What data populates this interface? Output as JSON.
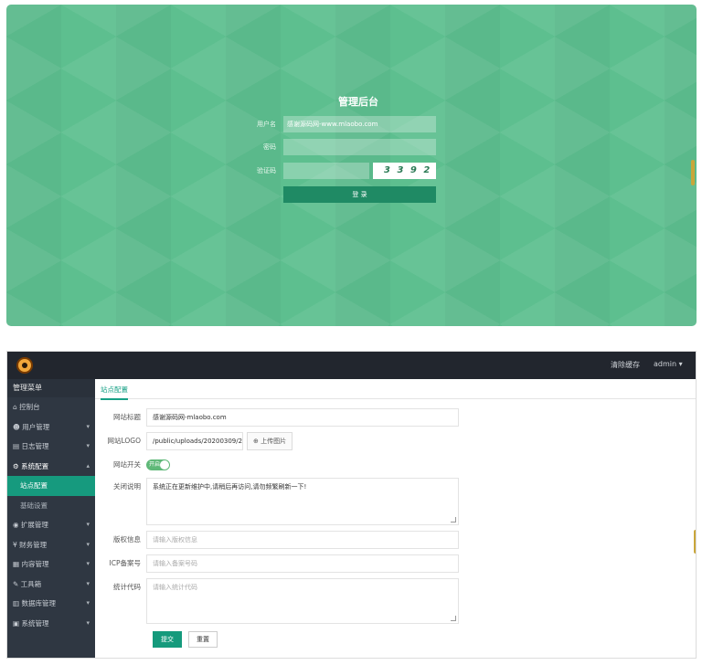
{
  "login": {
    "title": "管理后台",
    "username_label": "用户名",
    "username_value": "感谢源码网-www.mlaobo.com",
    "password_label": "密码",
    "password_value": "",
    "captcha_label": "验证码",
    "captcha_value": "",
    "captcha_image_text": "3 3 9 2",
    "login_button": "登 录"
  },
  "topbar": {
    "clear_cache": "清除缓存",
    "user": "admin ▾"
  },
  "sidebar": {
    "title": "管理菜单",
    "items": [
      {
        "label": "控制台",
        "icon": "home-icon",
        "caret": ""
      },
      {
        "label": "用户管理",
        "icon": "user-icon",
        "caret": "▾"
      },
      {
        "label": "日志管理",
        "icon": "log-icon",
        "caret": "▾"
      },
      {
        "label": "系统配置",
        "icon": "gear-icon",
        "caret": "▴"
      },
      {
        "label": "站点配置",
        "icon": "",
        "caret": ""
      },
      {
        "label": "基础设置",
        "icon": "",
        "caret": ""
      },
      {
        "label": "扩展管理",
        "icon": "extension-icon",
        "caret": "▾"
      },
      {
        "label": "财务管理",
        "icon": "finance-icon",
        "caret": "▾"
      },
      {
        "label": "内容管理",
        "icon": "content-icon",
        "caret": "▾"
      },
      {
        "label": "工具箱",
        "icon": "tool-icon",
        "caret": "▾"
      },
      {
        "label": "数据库管理",
        "icon": "database-icon",
        "caret": "▾"
      },
      {
        "label": "系统管理",
        "icon": "system-icon",
        "caret": "▾"
      }
    ]
  },
  "main": {
    "tab": "站点配置",
    "fields": {
      "site_title_label": "网站标题",
      "site_title_value": "感谢源码网-mlaobo.com",
      "site_logo_label": "网站LOGO",
      "site_logo_value": "/public/uploads/20200309/20",
      "upload_button": "上传图片",
      "site_switch_label": "网站开关",
      "site_switch_text": "开启",
      "close_notice_label": "关闭说明",
      "close_notice_value": "系统正在更新维护中,请稍后再访问,请勿频繁刷新一下!",
      "copyright_label": "版权信息",
      "copyright_placeholder": "请输入版权信息",
      "icp_label": "ICP备案号",
      "icp_placeholder": "请输入备案号码",
      "stats_label": "统计代码",
      "stats_placeholder": "请输入统计代码"
    },
    "submit_button": "提交",
    "reset_button": "重置"
  }
}
